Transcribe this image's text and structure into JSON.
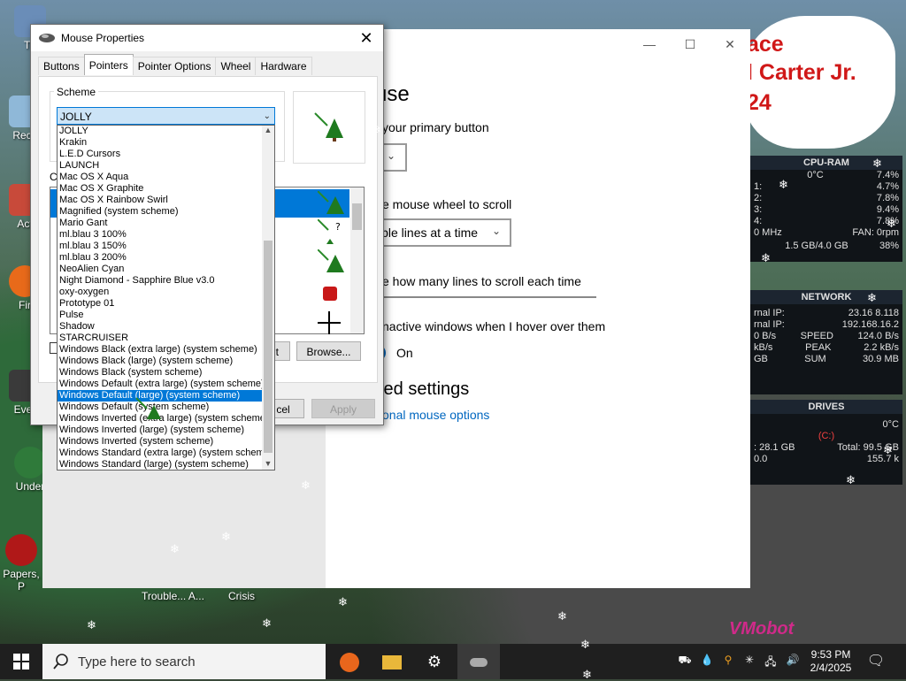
{
  "desktop": {
    "icons": [
      "Th",
      "Recy",
      "Act",
      "Fir",
      "Ever",
      "Under",
      "Papers, P"
    ],
    "speech_lines": [
      "ace",
      "l Carter Jr.",
      "24"
    ],
    "bottom_labels": [
      "Trouble... A...",
      "Crisis"
    ],
    "watermark": "VMobot"
  },
  "widget": {
    "cpu": {
      "title": "CPU-RAM",
      "temp": "0°C",
      "total": "7.4%",
      "cores": [
        {
          "n": "1:",
          "v": "4.7%"
        },
        {
          "n": "2:",
          "v": "7.8%"
        },
        {
          "n": "3:",
          "v": "9.4%"
        },
        {
          "n": "4:",
          "v": "7.8%"
        }
      ],
      "clock": "0 MHz",
      "fan": "FAN: 0rpm",
      "ram": "1.5 GB/4.0 GB",
      "ram_pct": "38%"
    },
    "network": {
      "title": "NETWORK",
      "internal_ip_label": "rnal IP:",
      "internal_ip": "23.16 8.118",
      "external_ip_label": "rnal IP:",
      "external_ip": "192.168.16.2",
      "speed_left": "0 B/s",
      "speed_label": "SPEED",
      "speed_right": "124.0 B/s",
      "peak_left": "kB/s",
      "peak_label": "PEAK",
      "peak_right": "2.2 kB/s",
      "sum_left": "GB",
      "sum_label": "SUM",
      "sum_right": "30.9 MB"
    },
    "drives": {
      "title": "DRIVES",
      "temp": "0°C",
      "drive": "(C:)",
      "used": ": 28.1 GB",
      "total": "Total: 99.5 GB",
      "read": "0.0",
      "write": "155.7 k"
    }
  },
  "settings": {
    "title_partial": "use",
    "primary_button_label": "your primary button",
    "wheel_label": "e mouse wheel to scroll",
    "wheel_value": "iple lines at a time",
    "lines_label": "e how many lines to scroll each time",
    "inactive_label": "nactive windows when I hover over them",
    "toggle_value": "On",
    "related_heading": "ted settings",
    "additional_link": "onal mouse options",
    "controls": {
      "minimize": "—",
      "maximize": "☐",
      "close": "✕"
    }
  },
  "dialog": {
    "title": "Mouse Properties",
    "tabs": [
      "Buttons",
      "Pointers",
      "Pointer Options",
      "Wheel",
      "Hardware"
    ],
    "active_tab": "Pointers",
    "scheme_label": "Scheme",
    "scheme_value": "JOLLY",
    "customize_label": "Cu",
    "buttons": {
      "default": "lt",
      "browse": "Browse...",
      "cancel": "cel",
      "apply": "Apply"
    }
  },
  "scheme_list": {
    "items": [
      "JOLLY",
      "Krakin",
      "L.E.D Cursors",
      "LAUNCH",
      "Mac OS X Aqua",
      "Mac OS X Graphite",
      "Mac OS X Rainbow Swirl",
      "Magnified (system scheme)",
      "Mario Gant",
      "ml.blau 3 100%",
      "ml.blau 3 150%",
      "ml.blau 3 200%",
      "NeoAlien Cyan",
      "Night Diamond - Sapphire Blue v3.0",
      "oxy-oxygen",
      "Prototype 01",
      "Pulse",
      "Shadow",
      "STARCRUISER",
      "Windows Black (extra large) (system scheme)",
      "Windows Black (large) (system scheme)",
      "Windows Black (system scheme)",
      "Windows Default (extra large) (system scheme)",
      "Windows Default (large) (system scheme)",
      "Windows Default (system scheme)",
      "Windows Inverted (extra large) (system scheme)",
      "Windows Inverted (large) (system scheme)",
      "Windows Inverted (system scheme)",
      "Windows Standard (extra large) (system scheme)",
      "Windows Standard (large) (system scheme)"
    ],
    "selected_index": 23
  },
  "taskbar": {
    "search_placeholder": "Type here to search",
    "time": "9:53 PM",
    "date": "2/4/2025"
  },
  "colors": {
    "accent": "#0078d7",
    "widget_bg": "#101418",
    "speech_red": "#d01818"
  }
}
